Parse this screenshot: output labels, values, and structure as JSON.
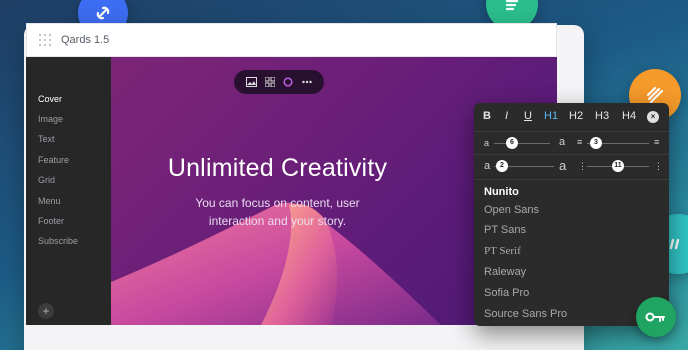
{
  "app": {
    "title": "Qards 1.5"
  },
  "sidebar": {
    "items": [
      {
        "label": "Cover",
        "active": true
      },
      {
        "label": "Image",
        "active": false
      },
      {
        "label": "Text",
        "active": false
      },
      {
        "label": "Feature",
        "active": false
      },
      {
        "label": "Grid",
        "active": false
      },
      {
        "label": "Menu",
        "active": false
      },
      {
        "label": "Footer",
        "active": false
      },
      {
        "label": "Subscribe",
        "active": false
      }
    ],
    "add_label": "+"
  },
  "hero": {
    "title": "Unlimited Creativity",
    "subtitle_line1": "You can focus on content, user",
    "subtitle_line2": "interaction and your story."
  },
  "toolbar": {
    "icons": [
      "image-icon",
      "grid-icon",
      "color-circle-icon",
      "more-icon"
    ],
    "color_accent": "#b65bd6"
  },
  "format_panel": {
    "bold": "B",
    "italic": "I",
    "underline": "U",
    "h1": "H1",
    "h2": "H2",
    "h3": "H3",
    "h4": "H4",
    "close": "×",
    "sliders": [
      {
        "left_label": "a",
        "value": "6",
        "right_label": "a"
      },
      {
        "left_label": "≡",
        "value": "3",
        "right_label": "≡"
      },
      {
        "left_label": "a",
        "value": "2",
        "right_label": "a"
      },
      {
        "left_label": "⋮",
        "value": "11",
        "right_label": "⋮"
      }
    ],
    "fonts": [
      "Nunito",
      "Open Sans",
      "PT Sans",
      "PT Serif",
      "Raleway",
      "Sofia Pro",
      "Source Sans Pro"
    ],
    "selected_font": "Nunito",
    "accent_color": "#54b8ef"
  },
  "colors": {
    "hero_purple": "#6b1f78",
    "panel_bg": "#2b2b2b",
    "sidebar_bg": "#272727"
  }
}
